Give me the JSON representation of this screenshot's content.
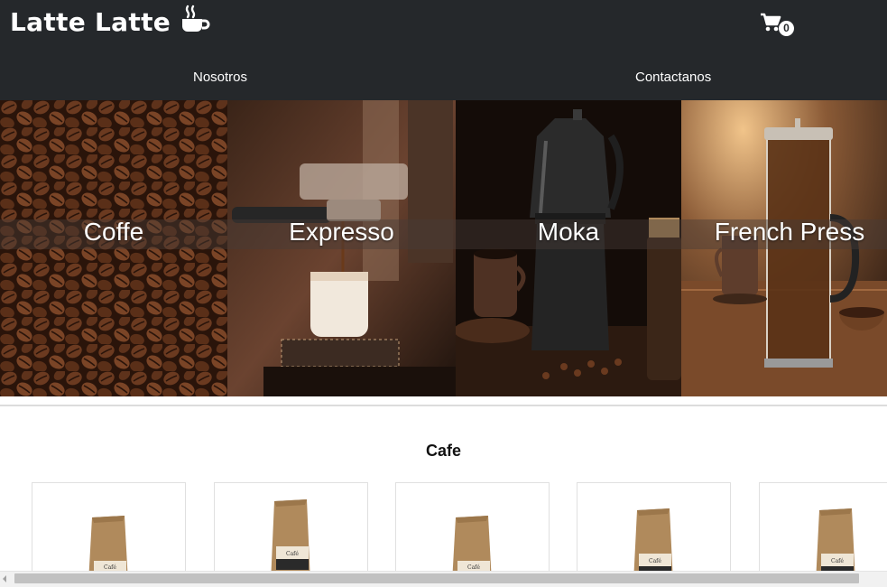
{
  "navbar": {
    "brand": "Latte Latte",
    "brand_icon": "coffee-cup-icon",
    "cart_icon": "shopping-cart-icon",
    "cart_count": "0",
    "links": [
      "Nosotros",
      "Contactanos"
    ]
  },
  "hero": {
    "panels": [
      {
        "label": "Coffe",
        "image": "coffee-beans"
      },
      {
        "label": "Expresso",
        "image": "espresso-machine"
      },
      {
        "label": "Moka",
        "image": "moka-pot"
      },
      {
        "label": "French Press",
        "image": "french-press"
      }
    ]
  },
  "section": {
    "title": "Cafe",
    "products": [
      {
        "image": "kraft-coffee-bag"
      },
      {
        "image": "kraft-coffee-bag-kenya"
      },
      {
        "image": "kraft-coffee-bag"
      },
      {
        "image": "kraft-coffee-bag-kenya"
      },
      {
        "image": "kraft-coffee-bag-kenya"
      }
    ]
  },
  "colors": {
    "navbar_bg": "#25282b",
    "navbar_text": "#ffffff",
    "hero_label": "#ffffff",
    "kraft": "#b08a5c"
  }
}
